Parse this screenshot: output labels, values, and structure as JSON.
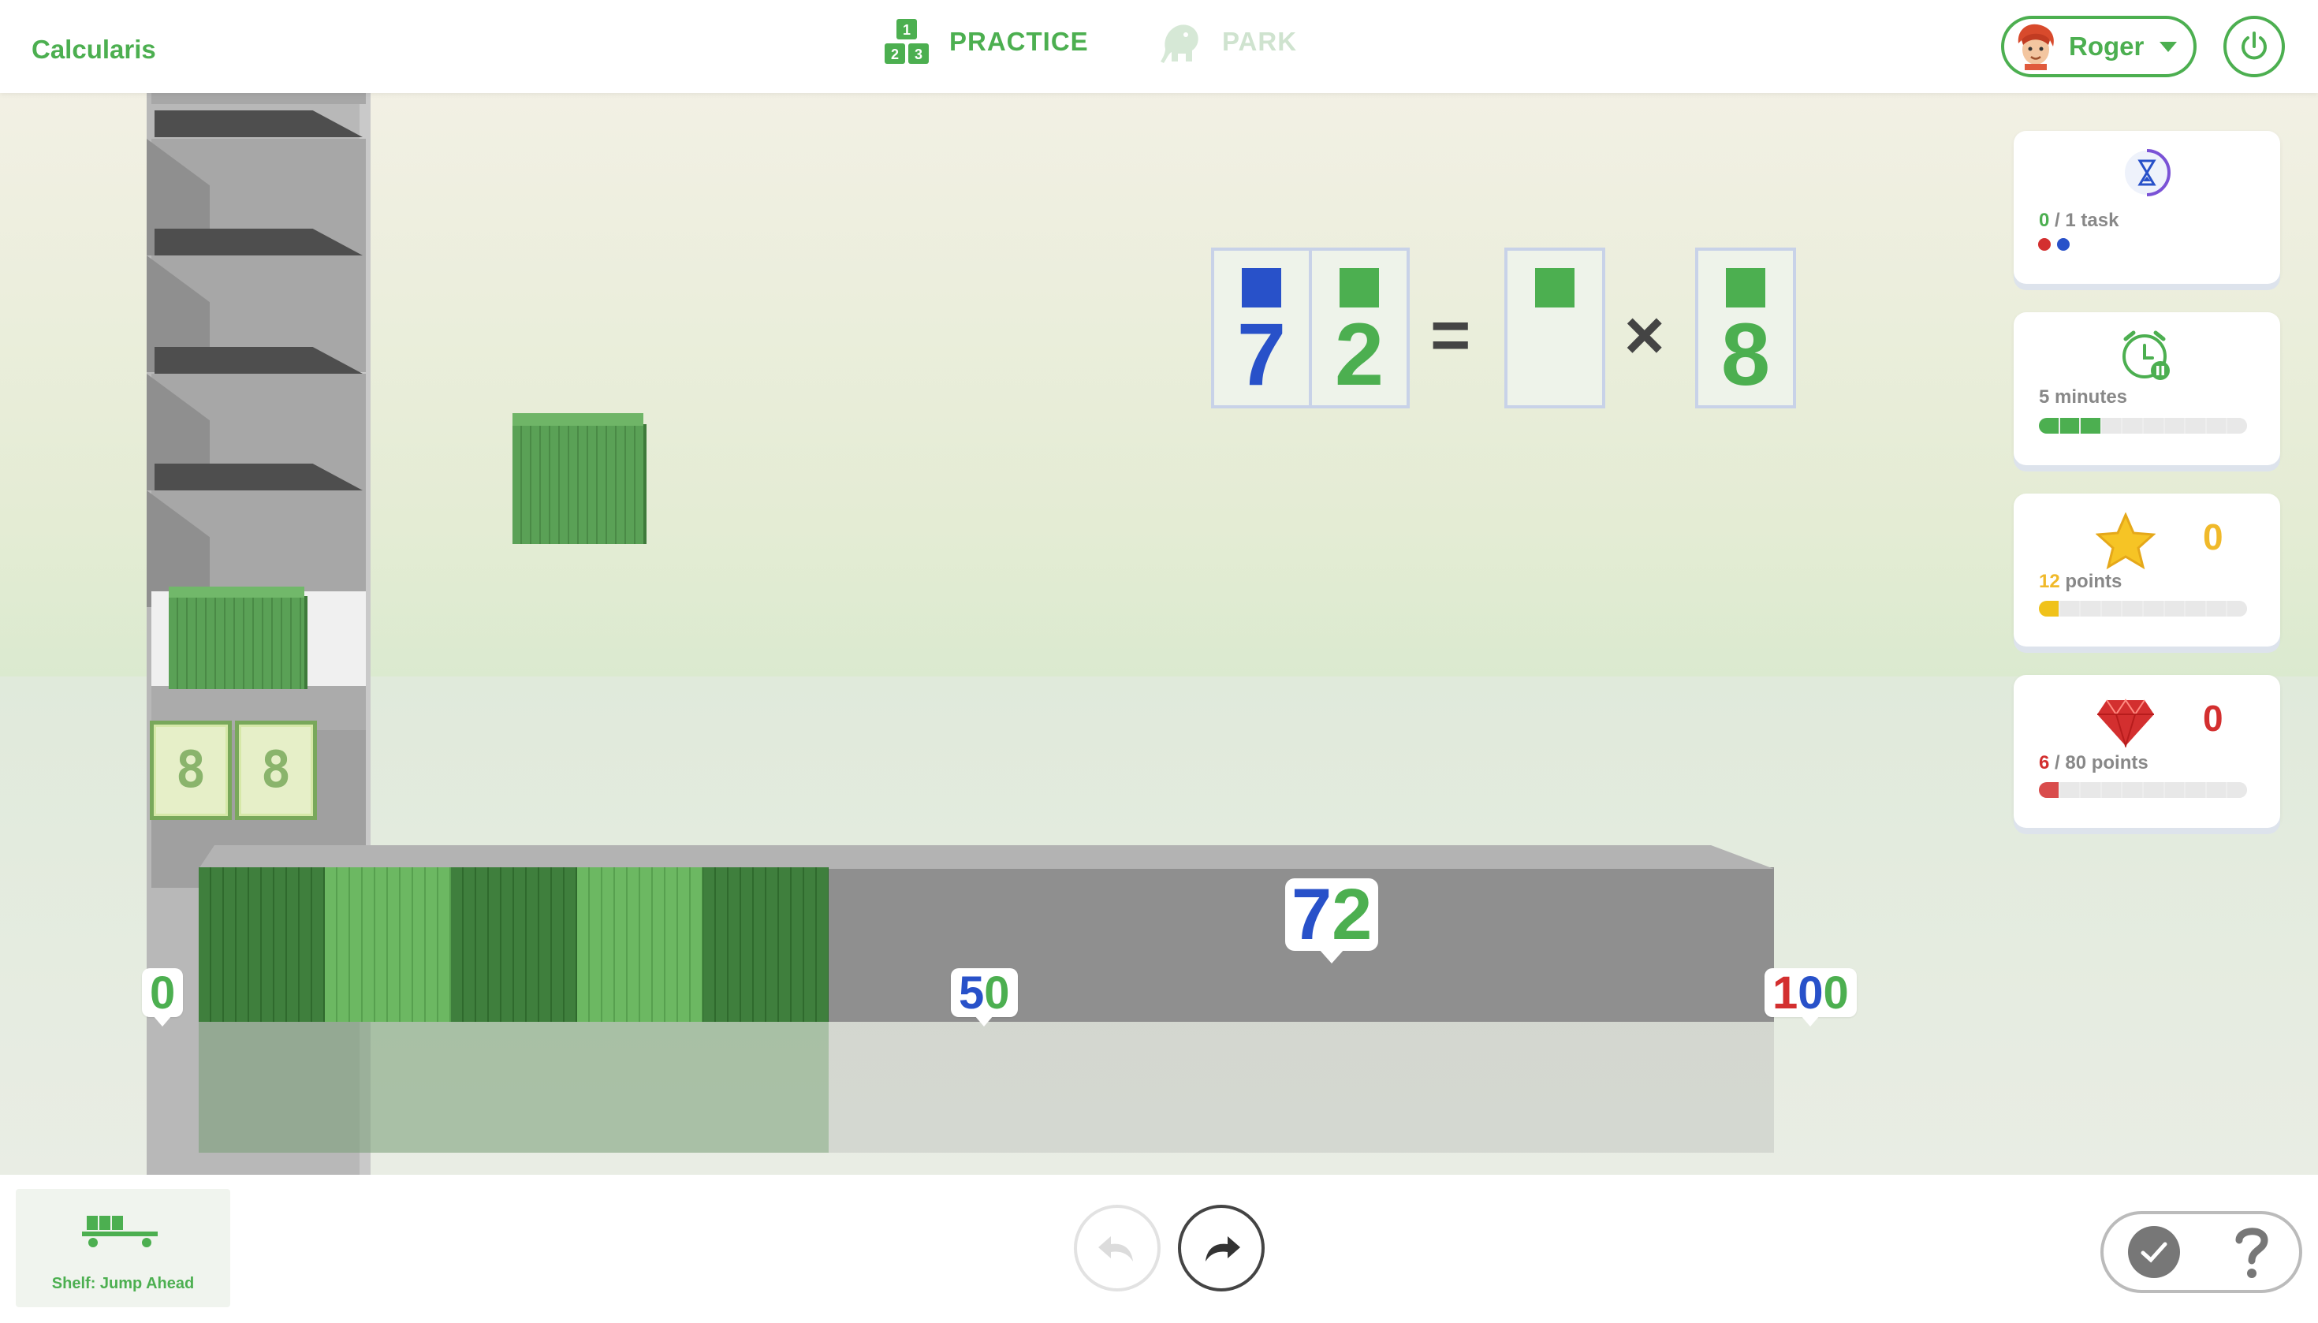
{
  "app": {
    "title": "Calcularis"
  },
  "nav": {
    "practice": {
      "label": "PRACTICE",
      "icon": "number-blocks-icon",
      "icon_digits": [
        "1",
        "2",
        "3"
      ]
    },
    "park": {
      "label": "PARK",
      "icon": "elephant-icon"
    }
  },
  "user": {
    "name": "Roger",
    "avatar": "red-haired-avatar"
  },
  "equation": {
    "lhs_tens": "7",
    "lhs_ones": "2",
    "equals": "=",
    "blank": "",
    "times": "×",
    "factor": "8",
    "colors": {
      "tens": "#2851c9",
      "ones": "#4caf50"
    }
  },
  "number_line": {
    "current": {
      "tens": "7",
      "ones": "2"
    },
    "start": "0",
    "mid": {
      "tens": "5",
      "ones": "0"
    },
    "end": {
      "hundreds": "1",
      "tens": "0",
      "ones": "0"
    },
    "fill_value": 40,
    "max": 100
  },
  "shelf_tiles": [
    "8",
    "8"
  ],
  "stats": {
    "task": {
      "done": "0",
      "total_text": " / 1 task",
      "icon": "hourglass-icon"
    },
    "time": {
      "label": "5 minutes",
      "icon": "alarm-clock-icon",
      "progress": 0.3
    },
    "stars": {
      "count": "0",
      "points": "12",
      "points_label": " points",
      "icon": "star-icon",
      "progress": 0.1
    },
    "gems": {
      "count": "0",
      "points": "6",
      "points_label": " / 80 points",
      "icon": "ruby-icon",
      "progress": 0.075
    }
  },
  "bottom": {
    "tool_label": "Shelf: Jump Ahead",
    "undo_icon": "undo-icon",
    "redo_icon": "redo-icon",
    "check_icon": "check-icon",
    "help_icon": "help-icon"
  }
}
